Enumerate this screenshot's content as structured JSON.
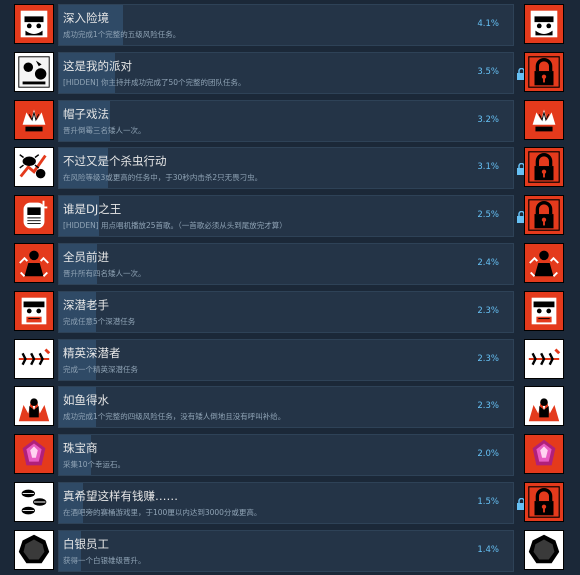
{
  "achievements": [
    {
      "title": "深入险境",
      "desc": "成功完成1个完整的五级风险任务。",
      "pct": "4.1%",
      "icon": "miner-face-icon",
      "right": "unlocked",
      "fill": 0.04
    },
    {
      "title": "这是我的派对",
      "desc": "[HIDDEN] 你主持并成功完成了50个完整的团队任务。",
      "pct": "3.5%",
      "icon": "party-icon",
      "right": "locked",
      "fill": 0.035
    },
    {
      "title": "帽子戏法",
      "desc": "晋升倒霉三名矮人一次。",
      "pct": "3.2%",
      "icon": "crown-hat-icon",
      "right": "unlocked",
      "fill": 0.032
    },
    {
      "title": "不过又是个杀虫行动",
      "desc": "在风险等级3或更高的任务中，于30秒内击杀2只无畏刁虫。",
      "pct": "3.1%",
      "icon": "bug-slash-icon",
      "right": "locked",
      "fill": 0.031
    },
    {
      "title": "谁是DJ之王",
      "desc": "[HIDDEN] 用点唱机播放25首歌。（一首歌必须从头到尾放完才算）",
      "pct": "2.5%",
      "icon": "jukebox-icon",
      "right": "locked",
      "fill": 0.025
    },
    {
      "title": "全员前进",
      "desc": "晋升所有四名矮人一次。",
      "pct": "2.4%",
      "icon": "four-dwarves-icon",
      "right": "unlocked",
      "fill": 0.024
    },
    {
      "title": "深潜老手",
      "desc": "完成任意5个深潜任务",
      "pct": "2.3%",
      "icon": "veteran-face-icon",
      "right": "unlocked",
      "fill": 0.023
    },
    {
      "title": "精英深潜者",
      "desc": "完成一个精英深潜任务",
      "pct": "2.3%",
      "icon": "elite-dive-icon",
      "right": "unlocked",
      "fill": 0.023
    },
    {
      "title": "如鱼得水",
      "desc": "成功完成1个完整的四级风险任务，没有矮人倒地且没有呼叫补给。",
      "pct": "2.3%",
      "icon": "flames-dwarf-icon",
      "right": "unlocked",
      "fill": 0.023
    },
    {
      "title": "珠宝商",
      "desc": "采集10个幸运石。",
      "pct": "2.0%",
      "icon": "gem-icon",
      "right": "unlocked",
      "fill": 0.02
    },
    {
      "title": "真希望这样有钱赚……",
      "desc": "在酒吧旁的赛桶游戏里，于100厘以内达到3000分或更高。",
      "pct": "1.5%",
      "icon": "barrels-icon",
      "right": "locked",
      "fill": 0.015
    },
    {
      "title": "白银员工",
      "desc": "获得一个白银雄级晋升。",
      "pct": "1.4%",
      "icon": "silver-badge-icon",
      "right": "unlocked",
      "fill": 0.014
    }
  ],
  "colors": {
    "background": "#1b2838",
    "panel": "#243447",
    "percent": "#66c0f4",
    "icon_red": "#e43a1c"
  }
}
